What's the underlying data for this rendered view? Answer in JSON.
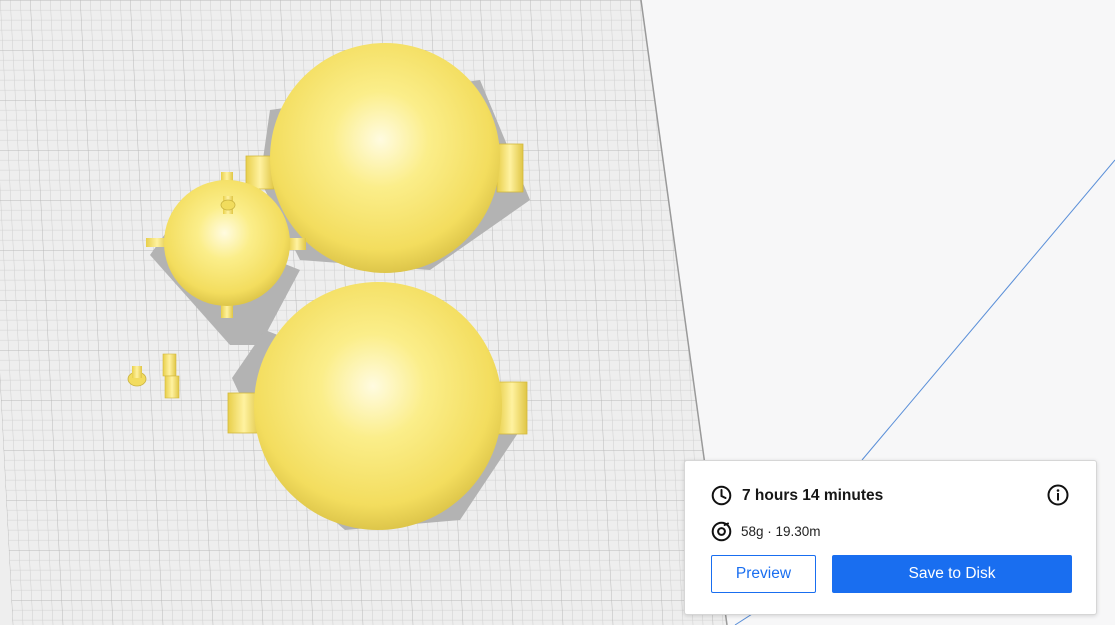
{
  "print_estimate": {
    "time": "7 hours 14 minutes",
    "material": "58g · 19.30m",
    "clock_icon": "clock-icon",
    "spool_icon": "spool-icon",
    "info_icon": "info-icon"
  },
  "actions": {
    "preview_label": "Preview",
    "save_label": "Save to Disk"
  },
  "colors": {
    "accent": "#196ef0",
    "model": "#f7e26c",
    "build_plate": "#eeeeee",
    "grid": "#c9c9c9",
    "background": "#f7f7f8"
  }
}
